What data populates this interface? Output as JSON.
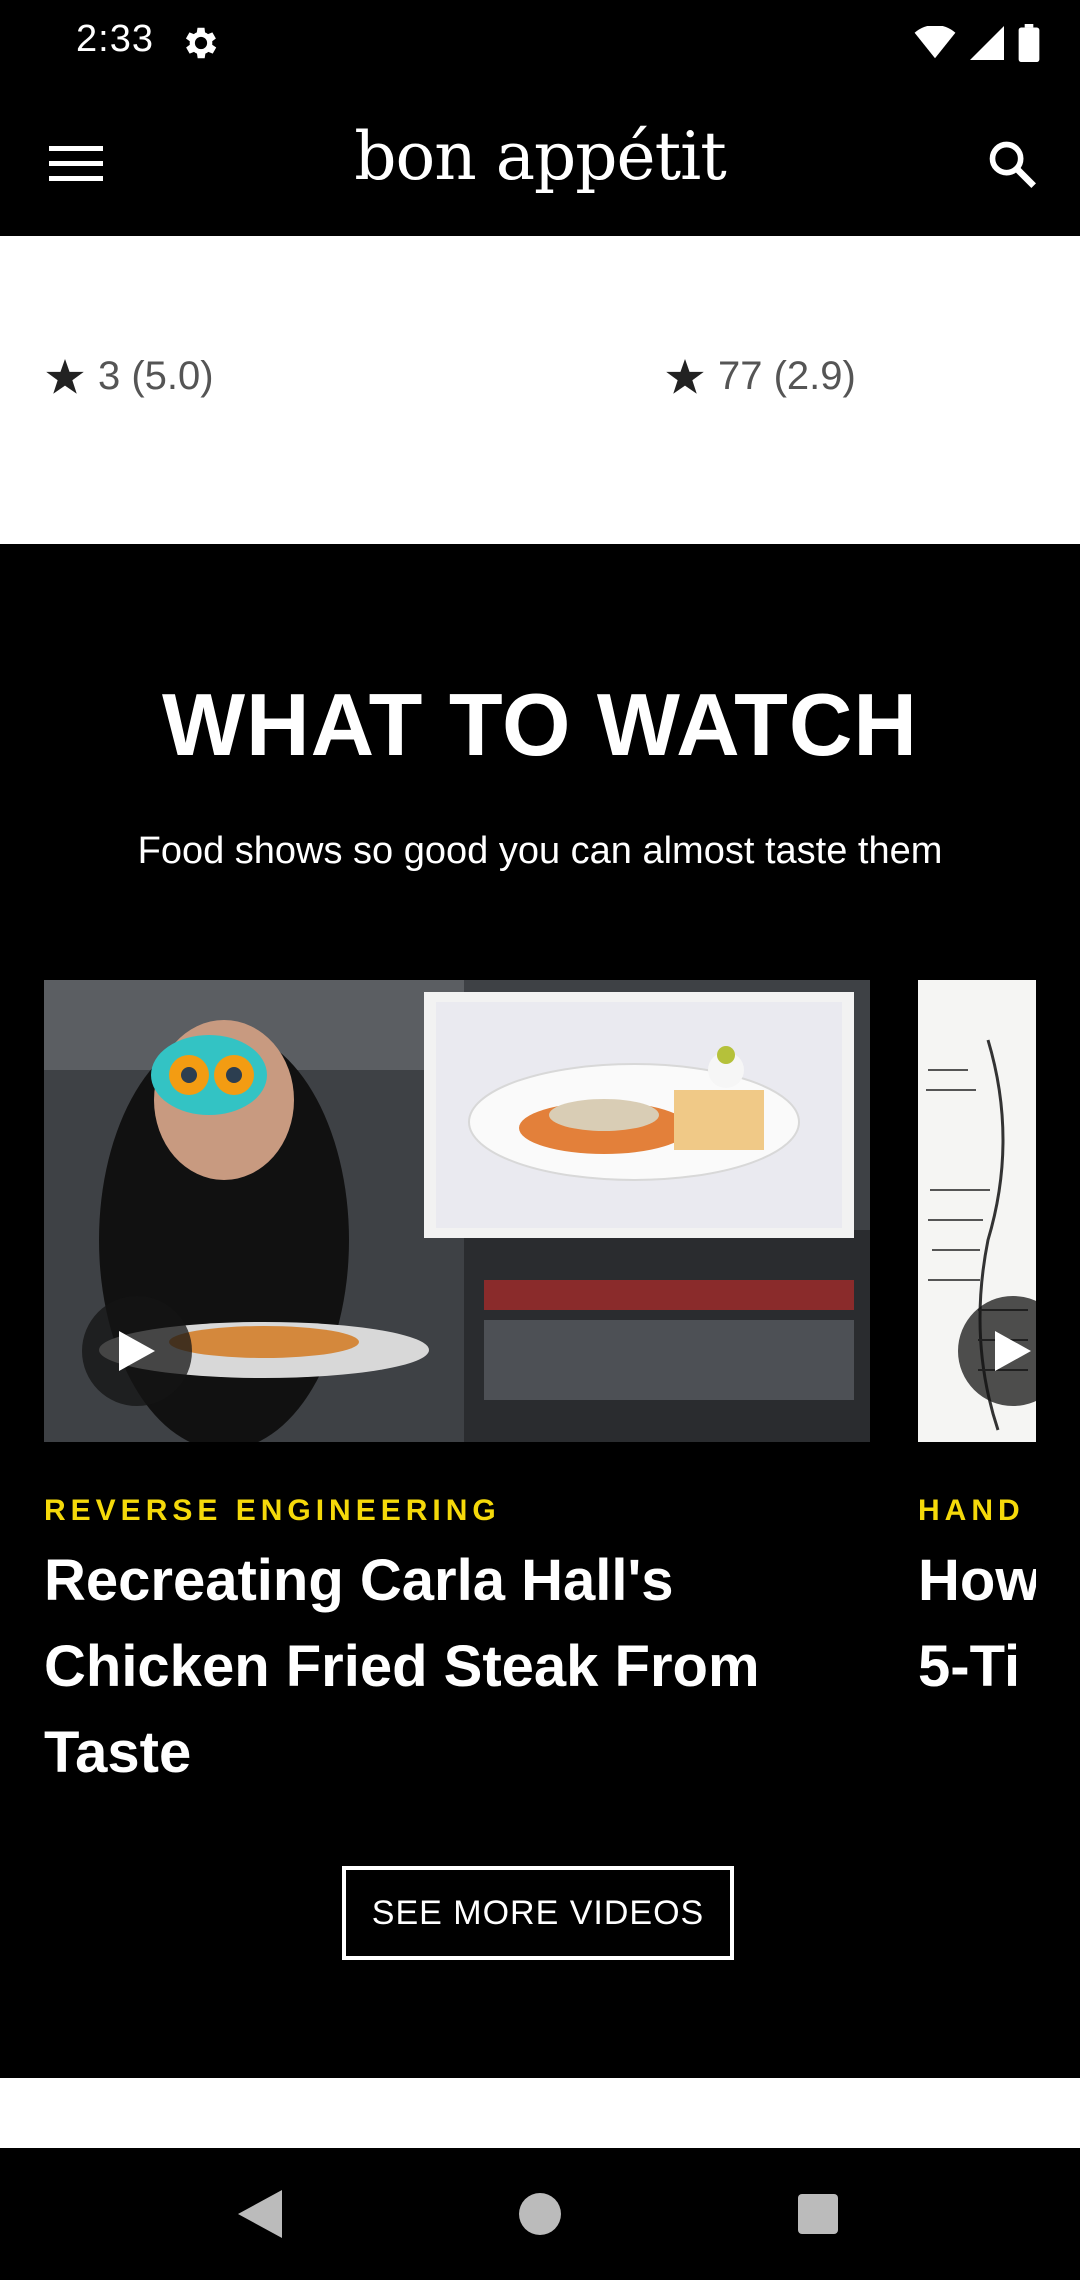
{
  "status_bar": {
    "time": "2:33",
    "icons": [
      "settings-gear-icon",
      "wifi-icon",
      "cell-signal-icon",
      "battery-icon"
    ]
  },
  "app_bar": {
    "brand": "bon appétit",
    "icons": [
      "hamburger-menu-icon",
      "search-icon"
    ]
  },
  "ratings": [
    {
      "text": "3 (5.0)",
      "icon": "star-icon"
    },
    {
      "text": "77 (2.9)",
      "icon": "star-icon"
    }
  ],
  "watch_section": {
    "title": "WHAT TO WATCH",
    "subtitle": "Food shows so good you can almost taste them",
    "cards": [
      {
        "kicker": "REVERSE ENGINEERING",
        "title": "Recreating Carla Hall's Chicken Fried Steak From Taste",
        "icon": "play-icon"
      },
      {
        "kicker": "HAND",
        "title": "How\n5-Ti",
        "icon": "play-icon"
      }
    ],
    "cta": "SEE MORE VIDEOS"
  },
  "colors": {
    "background_dark": "#000000",
    "kicker_yellow": "#f5d90a",
    "rating_text": "#555555"
  },
  "nav_bar": {
    "icons": [
      "back-icon",
      "home-icon",
      "recents-icon"
    ]
  }
}
